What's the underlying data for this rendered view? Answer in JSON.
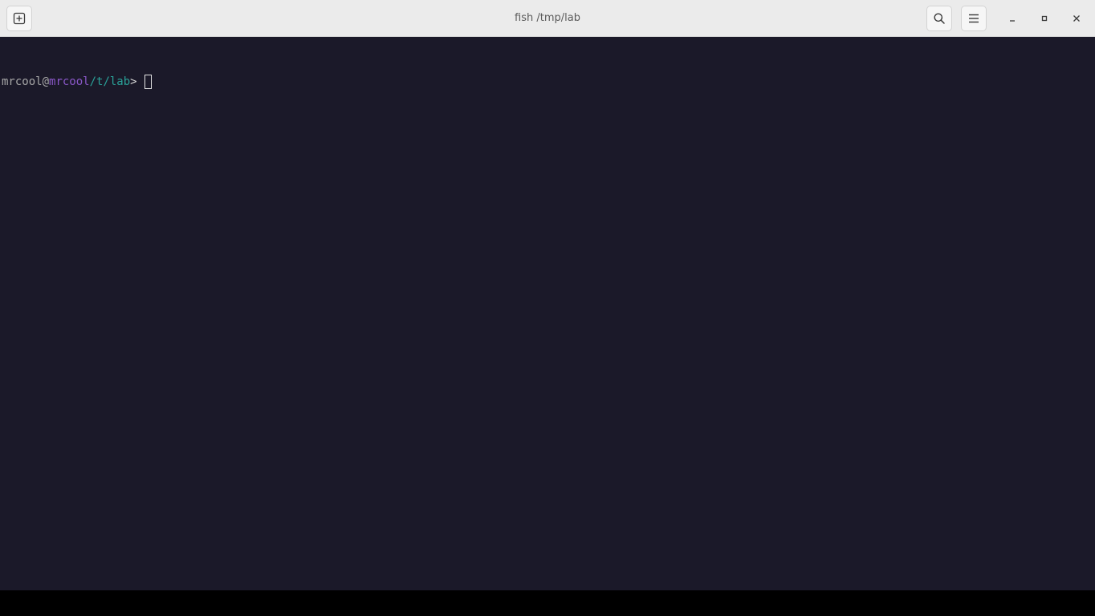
{
  "window": {
    "title": "fish /tmp/lab",
    "icons": {
      "new_tab": "new-tab-icon",
      "search": "search-icon",
      "menu": "hamburger-menu-icon",
      "minimize": "minimize-icon",
      "maximize": "maximize-icon",
      "close": "close-icon"
    }
  },
  "terminal": {
    "prompt": {
      "user": "mrcool",
      "at": "@",
      "host": "mrcool",
      "cwd": "/t/lab",
      "symbol": ">"
    },
    "colors": {
      "background": "#1b1929",
      "user": "#a7a7a7",
      "host": "#8b58c9",
      "cwd": "#2aa198"
    }
  }
}
